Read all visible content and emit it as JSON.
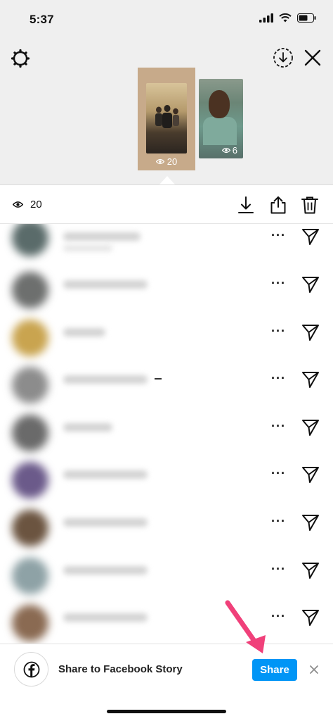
{
  "status_bar": {
    "time": "5:37"
  },
  "stories": [
    {
      "views": "20",
      "selected": true
    },
    {
      "views": "6",
      "selected": false
    }
  ],
  "viewer_bar": {
    "count": "20"
  },
  "viewers": [
    {
      "avatar_color": "#5a6b6a",
      "name_w": 110,
      "sub_w": 70
    },
    {
      "avatar_color": "#6d6f6e",
      "name_w": 120,
      "sub_w": 0
    },
    {
      "avatar_color": "#c9a44f",
      "name_w": 60,
      "sub_w": 0
    },
    {
      "avatar_color": "#8c8c8c",
      "name_w": 120,
      "sub_w": 0
    },
    {
      "avatar_color": "#6a6a6a",
      "name_w": 70,
      "sub_w": 0
    },
    {
      "avatar_color": "#6b5a8a",
      "name_w": 120,
      "sub_w": 0
    },
    {
      "avatar_color": "#6b5440",
      "name_w": 120,
      "sub_w": 0
    },
    {
      "avatar_color": "#8ea2a6",
      "name_w": 120,
      "sub_w": 0
    },
    {
      "avatar_color": "#8a6a52",
      "name_w": 120,
      "sub_w": 0
    }
  ],
  "more_label": "···",
  "share_banner": {
    "text": "Share to Facebook Story",
    "button_label": "Share",
    "accent": "#0095f6"
  },
  "annotation": {
    "arrow_color": "#f0407a"
  }
}
